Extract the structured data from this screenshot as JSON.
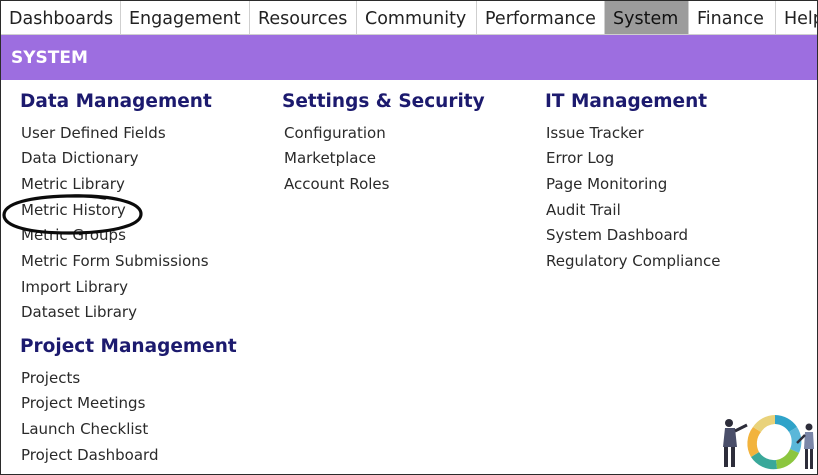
{
  "nav": {
    "tabs": [
      "Dashboards",
      "Engagement",
      "Resources",
      "Community",
      "Performance",
      "System",
      "Finance",
      "Help"
    ],
    "active_index": 5
  },
  "banner": {
    "title": "SYSTEM"
  },
  "sections": {
    "data_management": {
      "title": "Data Management",
      "items": [
        "User Defined Fields",
        "Data Dictionary",
        "Metric Library",
        "Metric History",
        "Metric Groups",
        "Metric Form Submissions",
        "Import Library",
        "Dataset Library"
      ]
    },
    "project_management": {
      "title": "Project Management",
      "items": [
        "Projects",
        "Project Meetings",
        "Launch Checklist",
        "Project Dashboard"
      ]
    },
    "settings_security": {
      "title": "Settings & Security",
      "items": [
        "Configuration",
        "Marketplace",
        "Account Roles"
      ]
    },
    "it_management": {
      "title": "IT Management",
      "items": [
        "Issue Tracker",
        "Error Log",
        "Page Monitoring",
        "Audit Trail",
        "System Dashboard",
        "Regulatory Compliance"
      ]
    }
  },
  "colors": {
    "banner": "#9d6ee0",
    "heading": "#1c1a6e",
    "active_tab": "#9c9c9c"
  },
  "highlight": {
    "circled_item": "Metric History"
  }
}
